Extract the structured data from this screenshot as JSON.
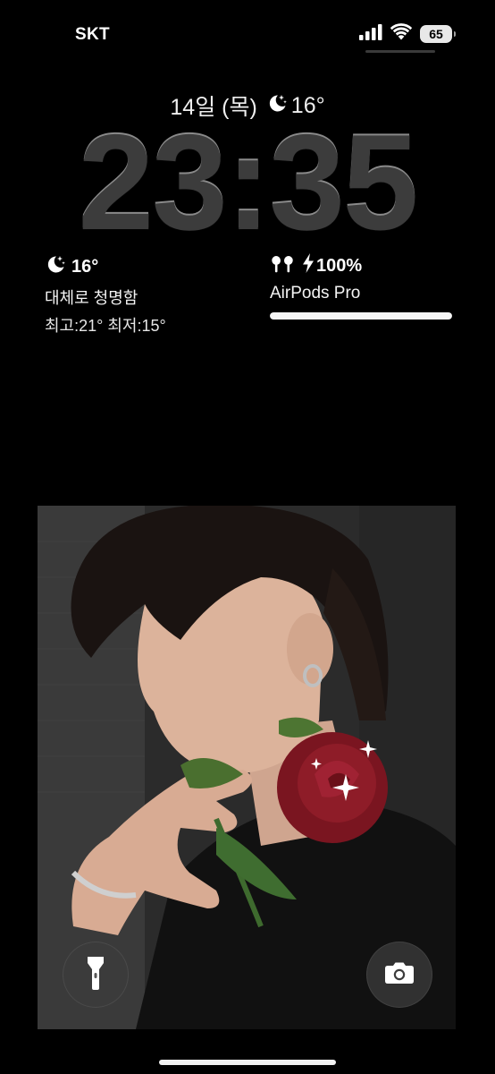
{
  "status_bar": {
    "carrier": "SKT",
    "battery_level": "65",
    "signal_icon": "cellular-signal-icon",
    "wifi_icon": "wifi-icon"
  },
  "lock_screen": {
    "date": "14일 (목)",
    "date_weather_temp": "16°",
    "time": "23:35"
  },
  "weather_widget": {
    "temp": "16°",
    "condition": "대체로 청명함",
    "high_low": "최고:21° 최저:15°",
    "icon": "moon-stars-icon"
  },
  "airpods_widget": {
    "battery": "100%",
    "device_name": "AirPods Pro",
    "level": 1.0,
    "icon": "airpods-icon"
  },
  "quick_actions": {
    "flashlight_icon": "flashlight-icon",
    "camera_icon": "camera-icon"
  },
  "colors": {
    "background": "#000000",
    "clock": "#3c3c3c",
    "text": "#ffffff"
  }
}
